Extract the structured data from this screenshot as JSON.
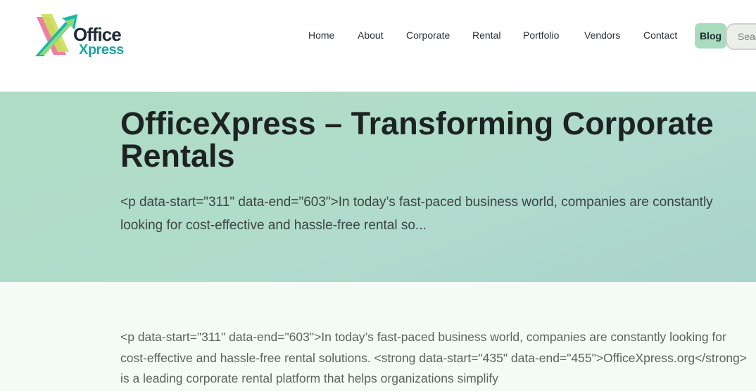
{
  "logo": {
    "line1": "Office",
    "line2": "Xpress"
  },
  "nav": {
    "items": [
      "Home",
      "About",
      "Corporate",
      "Rental",
      "Portfolio",
      "Vendors",
      "Contact"
    ],
    "blog": "Blog",
    "search_placeholder": "Search"
  },
  "hero": {
    "title": "OfficeXpress – Transforming Corporate Rentals",
    "excerpt": "<p data-start=\"311\" data-end=\"603\">In today’s fast-paced business world, companies are constantly looking for cost-effective and hassle-free rental so..."
  },
  "content": {
    "body": "<p data-start=\"311\" data-end=\"603\">In today’s fast-paced business world, companies are constantly looking for cost-effective and hassle-free rental solutions. <strong data-start=\"435\" data-end=\"455\">OfficeXpress.org</strong> is a leading corporate rental platform that helps organizations simplify"
  },
  "colors": {
    "hero_bg": "#aedcc4",
    "blog_pill": "#a9dcbf",
    "content_bg": "#f4faf6",
    "title_text": "#1d2322"
  },
  "icons": {
    "logo_mark": "upward-arrow-x-logo"
  }
}
